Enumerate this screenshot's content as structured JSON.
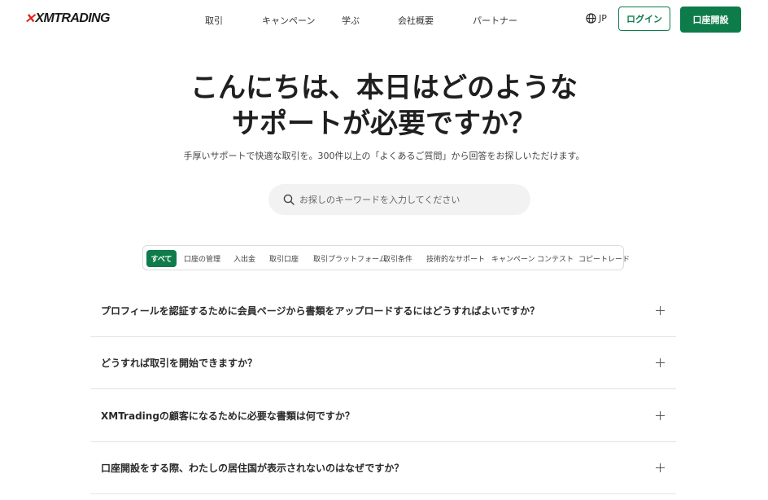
{
  "header": {
    "logo_mark": "✕",
    "logo_text": "XMTRADING",
    "nav": [
      "取引",
      "キャンペーン",
      "学ぶ",
      "会社概要",
      "パートナー"
    ],
    "language": "JP",
    "login_label": "ログイン",
    "open_account_label": "口座開設"
  },
  "hero": {
    "title_line1": "こんにちは、本日はどのような",
    "title_line2": "サポートが必要ですか？",
    "subtitle": "手厚いサポートで快適な取引を。300件以上の「よくあるご質問」から回答をお探しいただけます。"
  },
  "search": {
    "placeholder": "お探しのキーワードを入力してください",
    "value": ""
  },
  "tabs": [
    "すべて",
    "口座の管理",
    "入出金",
    "取引口座",
    "取引プラットフォーム",
    "取引条件",
    "技術的なサポート",
    "キャンペーン",
    "コンテスト",
    "コピートレード"
  ],
  "active_tab": "すべて",
  "faq": [
    "プロフィールを認証するために会員ページから書類をアップロードするにはどうすればよいですか？",
    "どうすれば取引を開始できますか？",
    "XMTradingの顧客になるために必要な書類は何ですか？",
    "口座開設をする際、わたしの居住国が表示されないのはなぜですか？"
  ],
  "colors": {
    "brand_green": "#0e7c4a",
    "logo_red": "#e1251b"
  }
}
